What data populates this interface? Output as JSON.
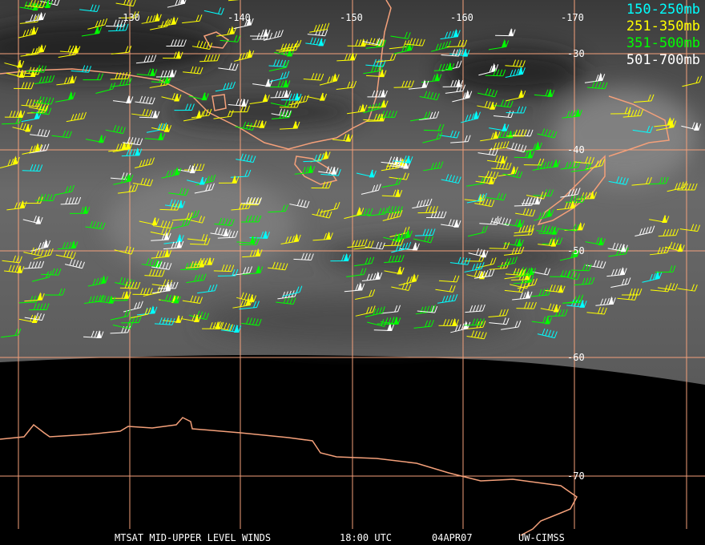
{
  "legend": [
    {
      "label": "150-250mb",
      "color": "#00ffff"
    },
    {
      "label": "251-350mb",
      "color": "#ffff00"
    },
    {
      "label": "351-500mb",
      "color": "#00ff00"
    },
    {
      "label": "501-700mb",
      "color": "#ffffff"
    }
  ],
  "longitude_labels": [
    "-130",
    "-140",
    "-150",
    "-160",
    "-170"
  ],
  "latitude_labels": [
    "-30",
    "-40",
    "-50",
    "-60",
    "-70"
  ],
  "caption": {
    "title": "MTSAT MID-UPPER LEVEL WINDS",
    "time": "18:00 UTC",
    "date": "04APR07",
    "source": "UW-CIMSS"
  },
  "colors": {
    "grid": "#f4a07a",
    "coast": "#f4a07a"
  }
}
